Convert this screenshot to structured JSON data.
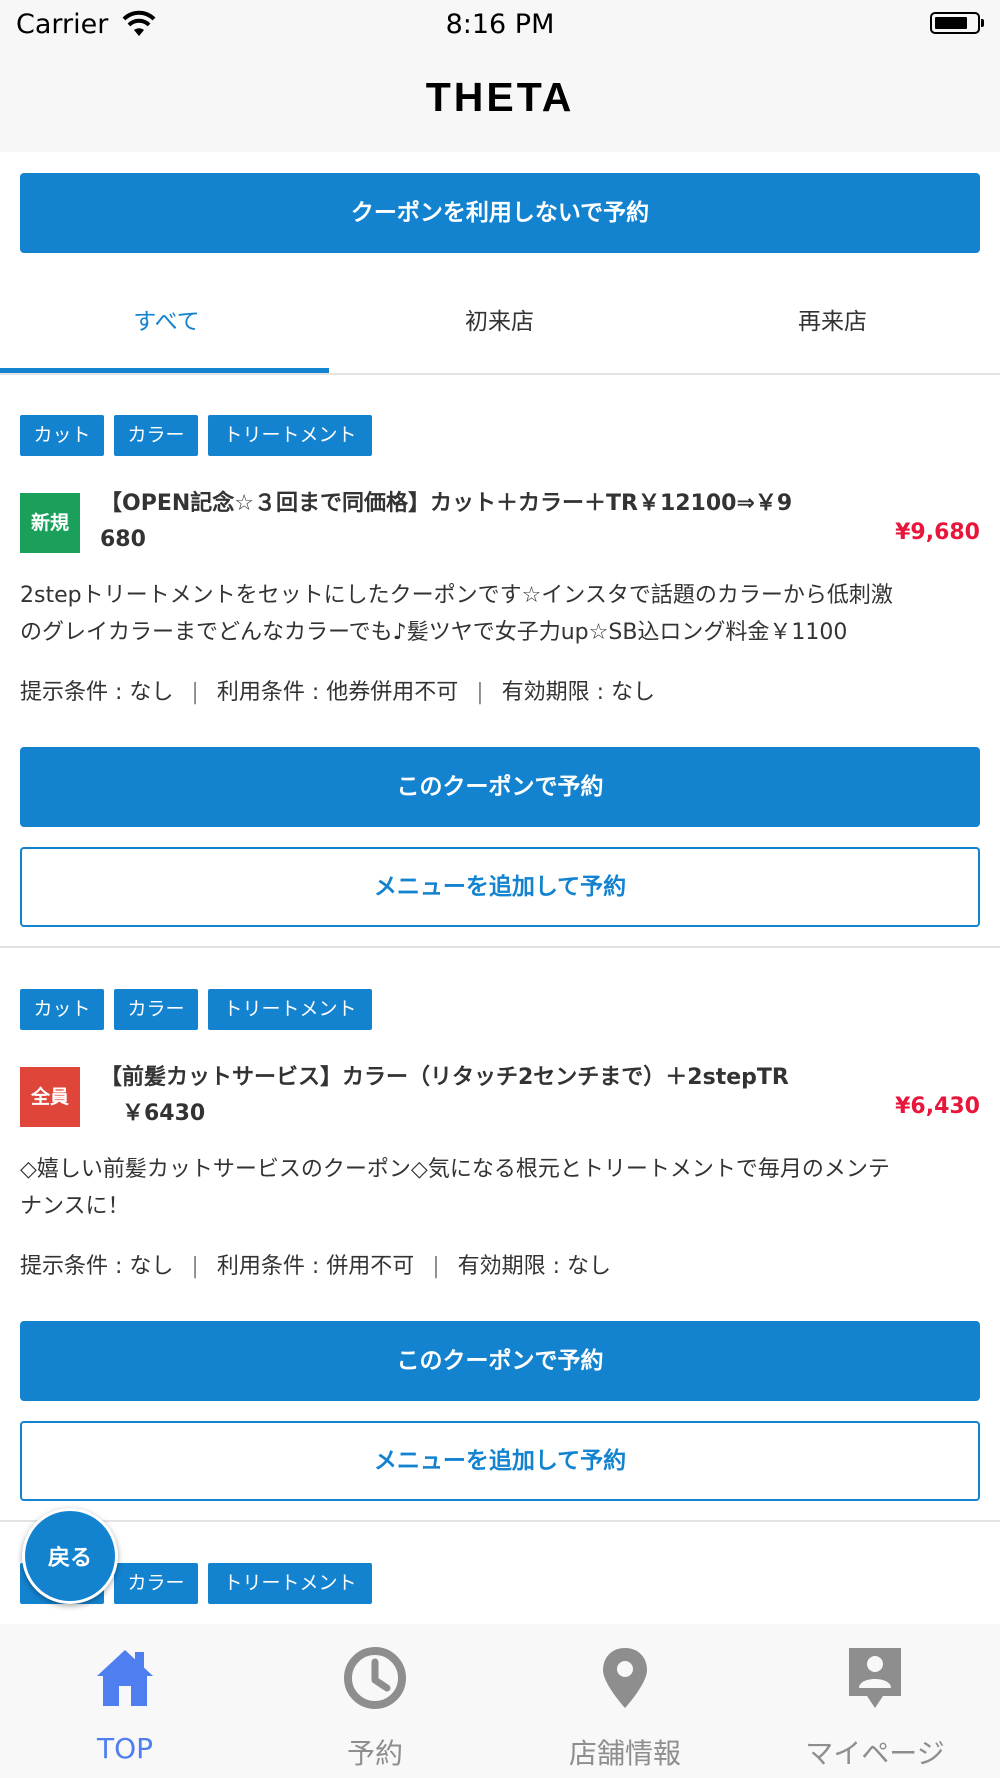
{
  "status_bar": {
    "carrier": "Carrier",
    "time": "8:16 PM"
  },
  "nav": {
    "title": "THETA"
  },
  "no_coupon_button": "クーポンを利用しないで予約",
  "tabs": [
    {
      "label": "すべて",
      "active": true
    },
    {
      "label": "初来店",
      "active": false
    },
    {
      "label": "再来店",
      "active": false
    }
  ],
  "coupons": [
    {
      "tags": [
        "カット",
        "カラー",
        "トリートメント"
      ],
      "badge": "新規",
      "title_line1": "【OPEN記念☆３回まで同価格】カット＋カラー＋TR￥12100⇒￥9",
      "title_line2": "680",
      "price": "¥9,680",
      "desc_line1": "2stepトリートメントをセットにしたクーポンです☆インスタで話題のカラーから低刺激",
      "desc_line2": "のグレイカラーまでどんなカラーでも♪髪ツヤで女子力up☆SB込ロング料金￥1100",
      "cond_present": "提示条件 : なし",
      "cond_use": "利用条件 : 他券併用不可",
      "cond_expiry": "有効期限 : なし",
      "reserve_button": "このクーポンで予約",
      "add_menu_button": "メニューを追加して予約"
    },
    {
      "tags": [
        "カット",
        "カラー",
        "トリートメント"
      ],
      "badge": "全員",
      "title_line1": "【前髪カットサービス】カラー（リタッチ2センチまで）＋2stepTR",
      "title_line2": "￥6430",
      "price": "¥6,430",
      "desc_line1": "◇嬉しい前髪カットサービスのクーポン◇気になる根元とトリートメントで毎月のメンテ",
      "desc_line2": "ナンスに！",
      "cond_present": "提示条件 : なし",
      "cond_use": "利用条件 : 併用不可",
      "cond_expiry": "有効期限 : なし",
      "reserve_button": "このクーポンで予約",
      "add_menu_button": "メニューを追加して予約"
    },
    {
      "tags": [
        "カット",
        "カラー",
        "トリートメント"
      ]
    }
  ],
  "back_button": "戻る",
  "tab_bar": [
    {
      "label": "TOP",
      "icon": "home-icon",
      "active": true
    },
    {
      "label": "予約",
      "icon": "clock-icon",
      "active": false
    },
    {
      "label": "店舗情報",
      "icon": "map-pin-icon",
      "active": false
    },
    {
      "label": "マイページ",
      "icon": "user-card-icon",
      "active": false
    }
  ],
  "colors": {
    "primary": "#1383d0",
    "price": "#e8163a",
    "badge_new": "#1aa05a",
    "badge_all": "#e0453a",
    "tab_active": "#4e7ef0"
  }
}
